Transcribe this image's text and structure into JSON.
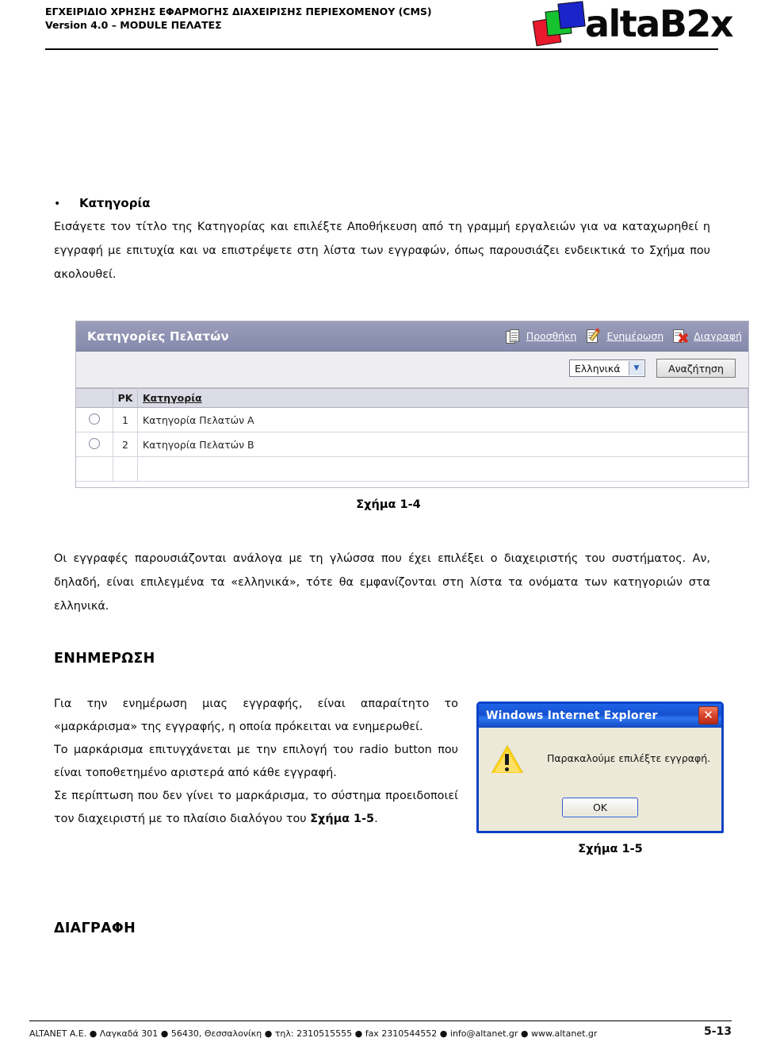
{
  "header": {
    "line1": "ΕΓΧΕΙΡΙΔΙΟ ΧΡΗΣΗΣ ΕΦΑΡΜΟΓΗΣ ΔΙΑΧΕΙΡΙΣΗΣ ΠΕΡΙΕΧΟΜΕΝΟΥ (CMS)",
    "line2": "Version 4.0 – MODULE ΠΕΛΑΤΕΣ",
    "logo_word": "altaB2x",
    "logo_colors": {
      "red": "#e8192c",
      "green": "#17c230",
      "blue": "#1b24c9"
    }
  },
  "body": {
    "bullet_marker": "•",
    "bullet_label": "Κατηγορία",
    "intro_paragraph": "Εισάγετε τον τίτλο της Κατηγορίας και επιλέξτε Αποθήκευση από τη γραμμή εργαλειών για να καταχωρηθεί η εγγραφή με επιτυχία και να επιστρέψετε στη λίστα των εγγραφών, όπως παρουσιάζει ενδεικτικά το Σχήμα που ακολουθεί.",
    "figure_caption_14": "Σχήμα 1-4",
    "language_paragraph": "Οι εγγραφές παρουσιάζονται ανάλογα με τη γλώσσα που έχει επιλέξει ο διαχειριστής του συστήματος. Αν, δηλαδή, είναι επιλεγμένα τα «ελληνικά», τότε θα εμφανίζονται στη λίστα τα ονόματα των κατηγοριών στα ελληνικά.",
    "section_update_heading": "ΕΝΗΜΕΡΩΣΗ",
    "update_paragraph_1": "Για την ενημέρωση μιας εγγραφής, είναι απαραίτητο το «μαρκάρισμα» της εγγραφής, η οποία πρόκειται να ενημερωθεί.",
    "update_paragraph_2": "Το μαρκάρισμα επιτυγχάνεται με την επιλογή του radio button που είναι τοποθετημένο αριστερά από κάθε εγγραφή.",
    "update_paragraph_3_a": "Σε περίπτωση που δεν γίνει το μαρκάρισμα, το σύστημα προειδοποιεί τον διαχειριστή με το πλαίσιο διαλόγου του ",
    "update_paragraph_3_b": "Σχήμα 1-5",
    "update_paragraph_3_c": ".",
    "figure_caption_15": "Σχήμα 1-5",
    "section_delete_heading": "ΔΙΑΓΡΑΦΗ"
  },
  "cms_figure": {
    "title": "Κατηγορίες Πελατών",
    "actions": [
      {
        "label": "Προσθήκη",
        "icon": "add-pages-icon"
      },
      {
        "label": "Ενημέρωση",
        "icon": "edit-pencil-icon"
      },
      {
        "label": "Διαγραφή",
        "icon": "delete-x-icon"
      }
    ],
    "language_select": {
      "value": "Ελληνικά",
      "arrow": "▼"
    },
    "search_button": "Αναζήτηση",
    "table": {
      "columns": [
        "",
        "PK",
        "Κατηγορία"
      ],
      "rows": [
        {
          "radio": "",
          "pk": "1",
          "name": "Κατηγορία Πελατών Α"
        },
        {
          "radio": "",
          "pk": "2",
          "name": "Κατηγορία Πελατών Β"
        }
      ]
    },
    "colors": {
      "titlebar": "#8f93b2",
      "header_row": "#dcdce6",
      "searchbar": "#eeeef1"
    }
  },
  "ie_dialog": {
    "title": "Windows Internet Explorer",
    "close_glyph": "✕",
    "message": "Παρακαλούμε επιλέξτε εγγραφή.",
    "ok_button": "OK",
    "colors": {
      "titlebar": "#1550cf",
      "border": "#0a42c8",
      "face": "#ece9d8",
      "close": "#d8412a",
      "warning": "#fcd116"
    }
  },
  "footer": {
    "text": "ALTANET A.E. ● Λαγκαδά 301 ● 56430, Θεσσαλονίκη ● τηλ: 2310515555 ● fax 2310544552 ● info@altanet.gr ● www.altanet.gr",
    "page_number": "5-13"
  }
}
